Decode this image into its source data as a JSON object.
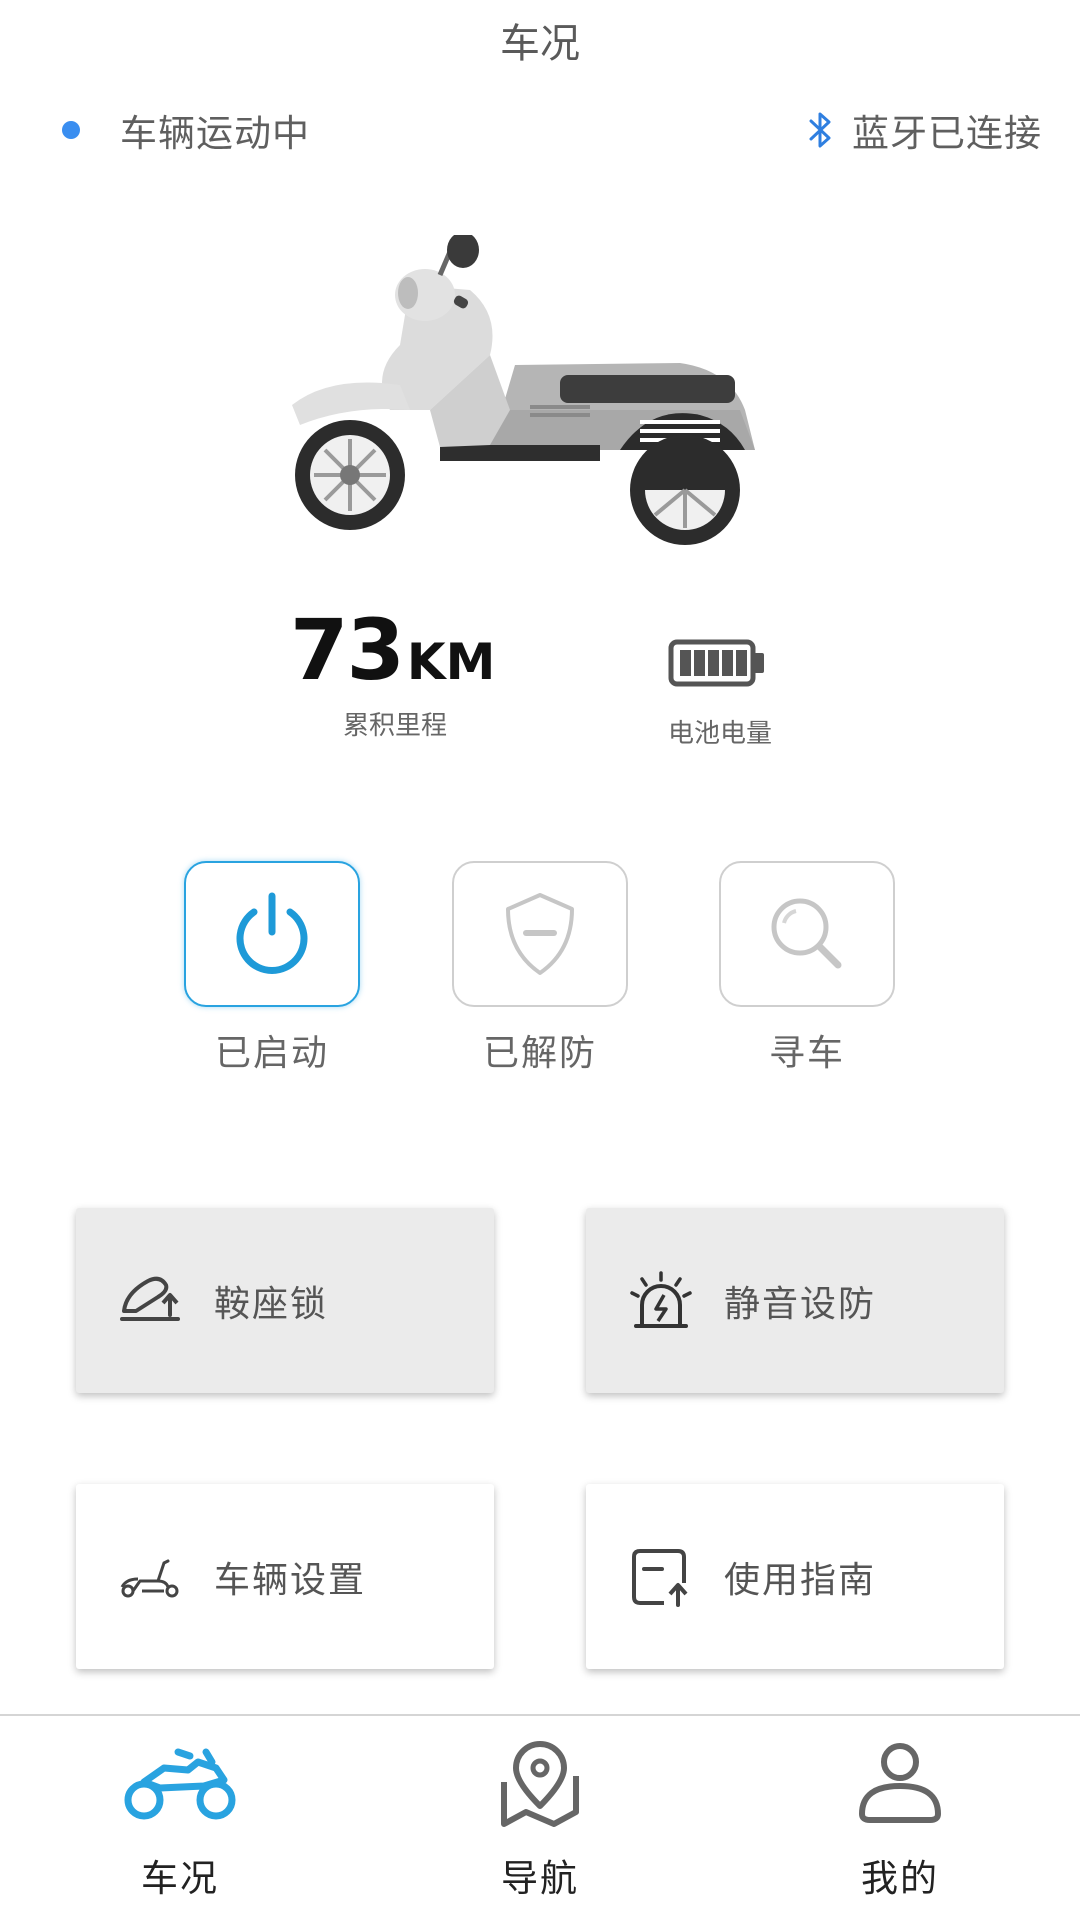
{
  "header": {
    "title": "车况"
  },
  "status": {
    "vehicle_state": "车辆运动中",
    "vehicle_dot_color": "#3a8ef0",
    "bluetooth_icon": "bluetooth-icon",
    "bluetooth_state": "蓝牙已连接"
  },
  "stats": {
    "mileage_value": "73",
    "mileage_unit": "KM",
    "mileage_label": "累积里程",
    "battery_icon": "battery-full-icon",
    "battery_level_bars": 5,
    "battery_label": "电池电量"
  },
  "actions": [
    {
      "label": "已启动",
      "icon": "power-icon",
      "active": true
    },
    {
      "label": "已解防",
      "icon": "shield-icon",
      "active": false
    },
    {
      "label": "寻车",
      "icon": "search-icon",
      "active": false
    }
  ],
  "cards": [
    {
      "label": "鞍座锁",
      "icon": "seat-lock-icon"
    },
    {
      "label": "静音设防",
      "icon": "alarm-icon"
    },
    {
      "label": "车辆设置",
      "icon": "scooter-icon"
    },
    {
      "label": "使用指南",
      "icon": "guide-icon"
    }
  ],
  "nav": [
    {
      "label": "车况",
      "icon": "motorbike-icon",
      "active": true
    },
    {
      "label": "导航",
      "icon": "map-pin-icon",
      "active": false
    },
    {
      "label": "我的",
      "icon": "user-icon",
      "active": false
    }
  ],
  "colors": {
    "accent": "#29a3e0",
    "card_gray": "#ebebeb",
    "text": "#555555"
  }
}
